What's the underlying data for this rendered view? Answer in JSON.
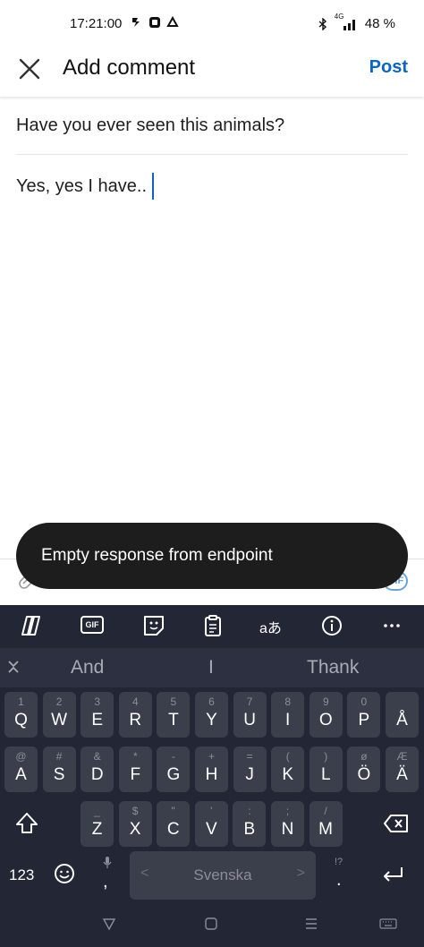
{
  "status_bar": {
    "time": "17:21:00",
    "battery": "48 %",
    "network": "4G"
  },
  "header": {
    "title": "Add comment",
    "post_label": "Post",
    "close_icon": "close-icon"
  },
  "content": {
    "question": "Have you ever seen this animals?",
    "answer": "Yes, yes I have.."
  },
  "composer": {
    "gif_label": "GIF"
  },
  "toast": {
    "message": "Empty response from endpoint"
  },
  "keyboard": {
    "toolbar": {
      "gif_label": "GIF",
      "translate_label": "aあ"
    },
    "suggestions": [
      "And",
      "I",
      "Thank"
    ],
    "row1": [
      {
        "hint": "1",
        "key": "Q"
      },
      {
        "hint": "2",
        "key": "W"
      },
      {
        "hint": "3",
        "key": "E"
      },
      {
        "hint": "4",
        "key": "R"
      },
      {
        "hint": "5",
        "key": "T"
      },
      {
        "hint": "6",
        "key": "Y"
      },
      {
        "hint": "7",
        "key": "U"
      },
      {
        "hint": "8",
        "key": "I"
      },
      {
        "hint": "9",
        "key": "O"
      },
      {
        "hint": "0",
        "key": "P"
      },
      {
        "hint": "",
        "key": "Å"
      }
    ],
    "row2": [
      {
        "hint": "@",
        "key": "A"
      },
      {
        "hint": "#",
        "key": "S"
      },
      {
        "hint": "&",
        "key": "D"
      },
      {
        "hint": "*",
        "key": "F"
      },
      {
        "hint": "-",
        "key": "G"
      },
      {
        "hint": "+",
        "key": "H"
      },
      {
        "hint": "=",
        "key": "J"
      },
      {
        "hint": "(",
        "key": "K"
      },
      {
        "hint": ")",
        "key": "L"
      },
      {
        "hint": "ø",
        "key": "Ö"
      },
      {
        "hint": "Æ",
        "key": "Ä"
      }
    ],
    "row3": [
      {
        "hint": "_",
        "key": "Z"
      },
      {
        "hint": "$",
        "key": "X"
      },
      {
        "hint": "\"",
        "key": "C"
      },
      {
        "hint": "'",
        "key": "V"
      },
      {
        "hint": ":",
        "key": "B"
      },
      {
        "hint": ";",
        "key": "N"
      },
      {
        "hint": "/",
        "key": "M"
      }
    ],
    "num_label": "123",
    "comma_label": ",",
    "period_label": ".",
    "period_hint": "!?",
    "space_label": "Svenska"
  }
}
